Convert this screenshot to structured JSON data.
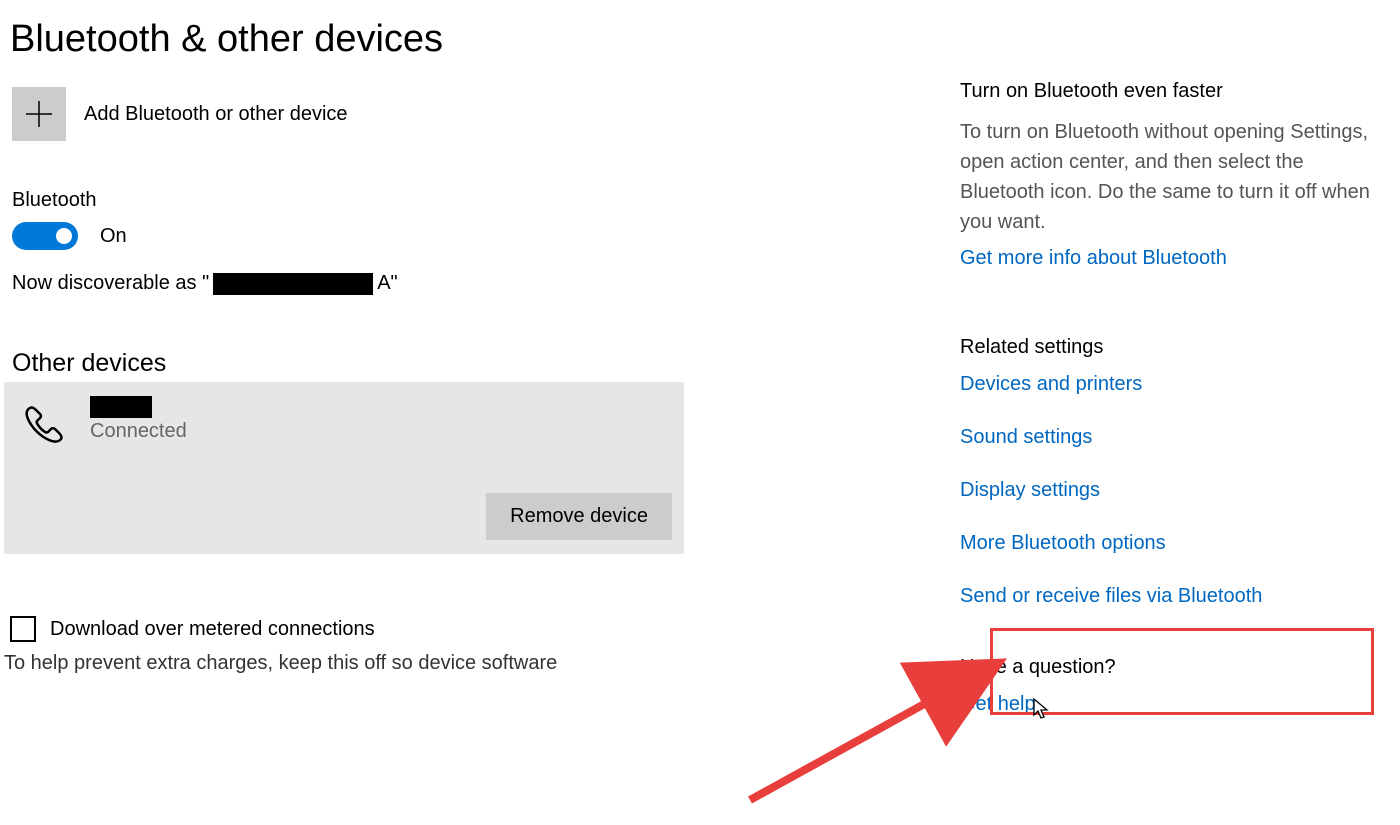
{
  "page": {
    "title": "Bluetooth & other devices"
  },
  "add": {
    "label": "Add Bluetooth or other device"
  },
  "bluetooth": {
    "heading": "Bluetooth",
    "state": "On",
    "discoverable_prefix": "Now discoverable as \"",
    "discoverable_redacted_trail": "A",
    "discoverable_suffix": "\""
  },
  "other_devices": {
    "heading": "Other devices",
    "device": {
      "status": "Connected",
      "remove_label": "Remove device"
    }
  },
  "metered": {
    "label": "Download over metered connections",
    "help": "To help prevent extra charges, keep this off so device software"
  },
  "side1": {
    "heading": "Turn on Bluetooth even faster",
    "body": "To turn on Bluetooth without opening Settings, open action center, and then select the Bluetooth icon. Do the same to turn it off when you want.",
    "link": "Get more info about Bluetooth"
  },
  "side2": {
    "heading": "Related settings",
    "links": {
      "a": "Devices and printers",
      "b": "Sound settings",
      "c": "Display settings",
      "d": "More Bluetooth options",
      "e": "Send or receive files via Bluetooth"
    }
  },
  "side3": {
    "heading": "Have a question?",
    "link": "Get help"
  }
}
